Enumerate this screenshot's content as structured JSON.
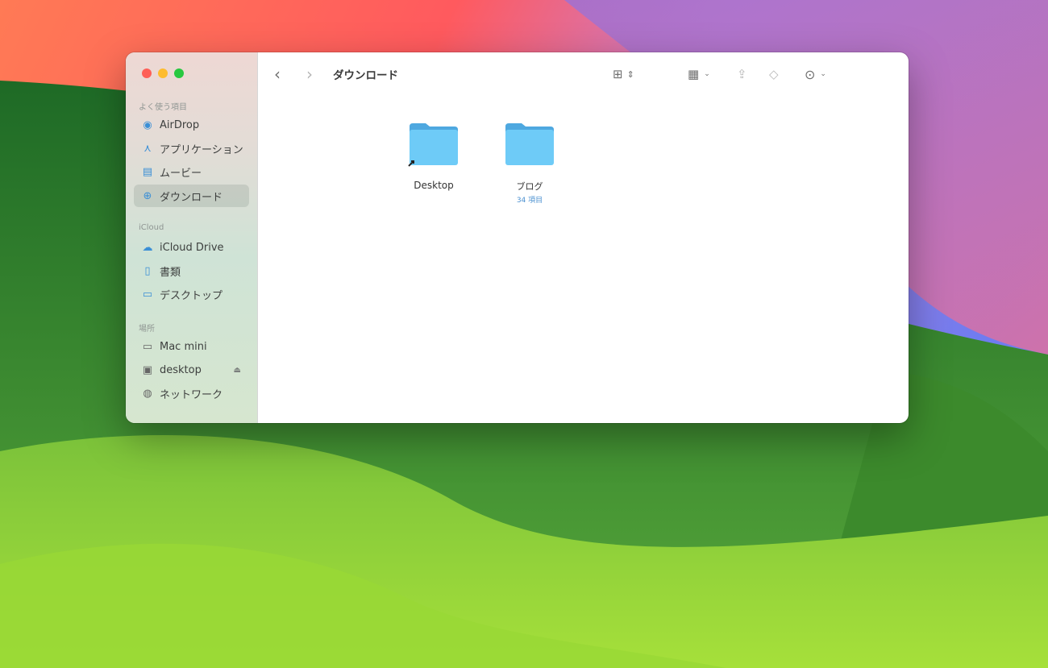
{
  "window": {
    "title": "ダウンロード"
  },
  "sidebar": {
    "sections": [
      {
        "label": "よく使う項目",
        "items": [
          {
            "label": "AirDrop",
            "icon": "airdrop-icon"
          },
          {
            "label": "アプリケーション",
            "icon": "applications-icon"
          },
          {
            "label": "ムービー",
            "icon": "movies-icon"
          },
          {
            "label": "ダウンロード",
            "icon": "downloads-icon",
            "selected": true
          }
        ]
      },
      {
        "label": "iCloud",
        "items": [
          {
            "label": "iCloud Drive",
            "icon": "cloud-icon"
          },
          {
            "label": "書類",
            "icon": "document-icon"
          },
          {
            "label": "デスクトップ",
            "icon": "desktop-icon"
          }
        ]
      },
      {
        "label": "場所",
        "items": [
          {
            "label": "Mac mini",
            "icon": "mac-mini-icon"
          },
          {
            "label": "desktop",
            "icon": "display-icon",
            "eject": true
          },
          {
            "label": "ネットワーク",
            "icon": "network-icon"
          }
        ]
      }
    ]
  },
  "files": [
    {
      "name": "Desktop",
      "alias": true
    },
    {
      "name": "ブログ",
      "subtitle": "34 項目"
    }
  ],
  "colors": {
    "folder": "#6ecbf7",
    "folder_tab": "#4ea8e0",
    "accent": "#3b8fd6"
  }
}
